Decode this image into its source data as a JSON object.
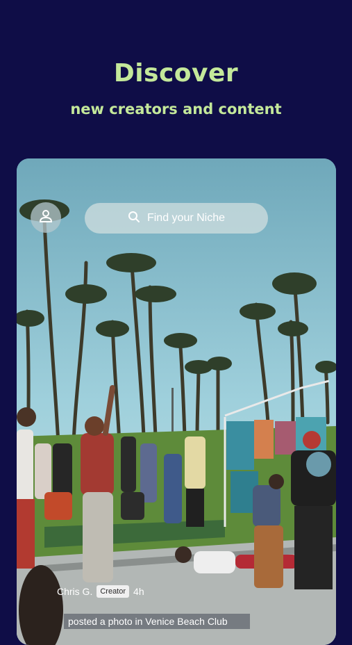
{
  "header": {
    "title": "Discover",
    "subtitle": "new creators and content"
  },
  "search": {
    "placeholder": "Find your Niche",
    "icon": "search-icon"
  },
  "profile": {
    "icon": "user-icon"
  },
  "post": {
    "author": "Chris G.",
    "badge": "Creator",
    "time": "4h",
    "caption": "posted a photo in Venice Beach Club"
  },
  "colors": {
    "background": "#0f0d47",
    "accent": "#c4e89a"
  }
}
